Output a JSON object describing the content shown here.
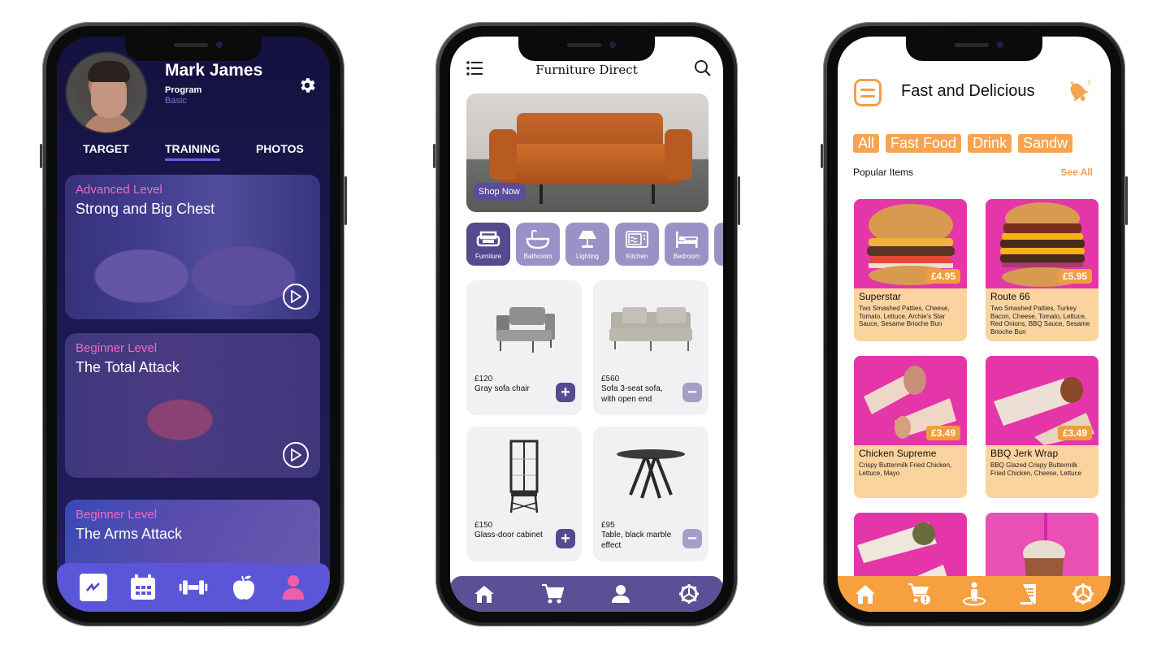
{
  "fitness_app": {
    "profile": {
      "name": "Mark James",
      "program_label": "Program",
      "program_value": "Basic"
    },
    "icons": {
      "settings": "gear-icon"
    },
    "tabs": [
      {
        "label": "TARGET",
        "active": false
      },
      {
        "label": "TRAINING",
        "active": true
      },
      {
        "label": "PHOTOS",
        "active": false
      }
    ],
    "workouts": [
      {
        "level": "Advanced Level",
        "title": "Strong and Big Chest",
        "icon": "play-icon"
      },
      {
        "level": "Beginner Level",
        "title": "The Total Attack",
        "icon": "play-icon"
      },
      {
        "level": "Beginner Level",
        "title": "The Arms Attack"
      }
    ],
    "bottom_nav": [
      "chart-icon",
      "calendar-icon",
      "dumbbell-icon",
      "apple-icon",
      "user-icon"
    ],
    "colors": {
      "accent": "#5b55d8",
      "level": "#ee6cc4",
      "plan": "#7a6ee0",
      "active_nav_icon": "#ee5fa8"
    }
  },
  "furniture_app": {
    "header": {
      "title": "Furniture Direct",
      "menu_icon": "list-icon",
      "search_icon": "search-icon"
    },
    "hero": {
      "button_label": "Shop Now"
    },
    "categories": [
      {
        "label": "Furniture",
        "icon": "sofa-icon",
        "active": true
      },
      {
        "label": "Bathroom",
        "icon": "bathtub-icon",
        "active": false
      },
      {
        "label": "Lighting",
        "icon": "lamp-icon",
        "active": false
      },
      {
        "label": "Kitchen",
        "icon": "microwave-icon",
        "active": false
      },
      {
        "label": "Bedroom",
        "icon": "bed-icon",
        "active": false
      }
    ],
    "products": [
      {
        "price": "£120",
        "name": "Gray sofa chair",
        "action": "+"
      },
      {
        "price": "£560",
        "name": "Sofa 3-seat sofa, with open end",
        "action": "−"
      },
      {
        "price": "£150",
        "name": "Glass-door cabinet",
        "action": "+"
      },
      {
        "price": "£95",
        "name": "Table, black marble effect",
        "action": "−"
      }
    ],
    "bottom_nav": [
      "home-icon",
      "cart-icon",
      "user-icon",
      "settings-icon"
    ],
    "colors": {
      "primary": "#554a8e",
      "secondary": "#9a92c6"
    }
  },
  "food_app": {
    "header": {
      "title": "Fast and Delicious",
      "notification_count": "1"
    },
    "chips": [
      "All",
      "Fast Food",
      "Drink",
      "Sandw"
    ],
    "section": {
      "title": "Popular Items",
      "see_all": "See All"
    },
    "items": [
      {
        "name": "Superstar",
        "price": "£4.95",
        "description": "Two Smashed Patties, Cheese, Tomato, Lettuce, Archie's Star Sauce, Sesame Brioche Bun"
      },
      {
        "name": "Route 66",
        "price": "£5.95",
        "description": "Two Smashed Patties, Turkey Bacon, Cheese, Tomato, Lettuce, Red Onions, BBQ Sauce, Sesame Brioche Bun"
      },
      {
        "name": "Chicken Supreme",
        "price": "£3.49",
        "description": "Crispy Buttermilk Fried Chicken, Lettuce, Mayo"
      },
      {
        "name": "BBQ Jerk Wrap",
        "price": "£3.49",
        "description": "BBQ Glazed Crispy Buttermilk Fried Chicken, Cheese, Lettuce"
      },
      {
        "name": "",
        "price": "",
        "description": ""
      },
      {
        "name": "",
        "price": "",
        "description": ""
      }
    ],
    "bottom_nav": [
      "home-icon",
      "cart-alert-icon",
      "location-person-icon",
      "receipt-icon",
      "settings-icon"
    ],
    "colors": {
      "primary": "#f6a03f",
      "card": "#fbd39e",
      "photo_bg": "#e436a8"
    }
  }
}
